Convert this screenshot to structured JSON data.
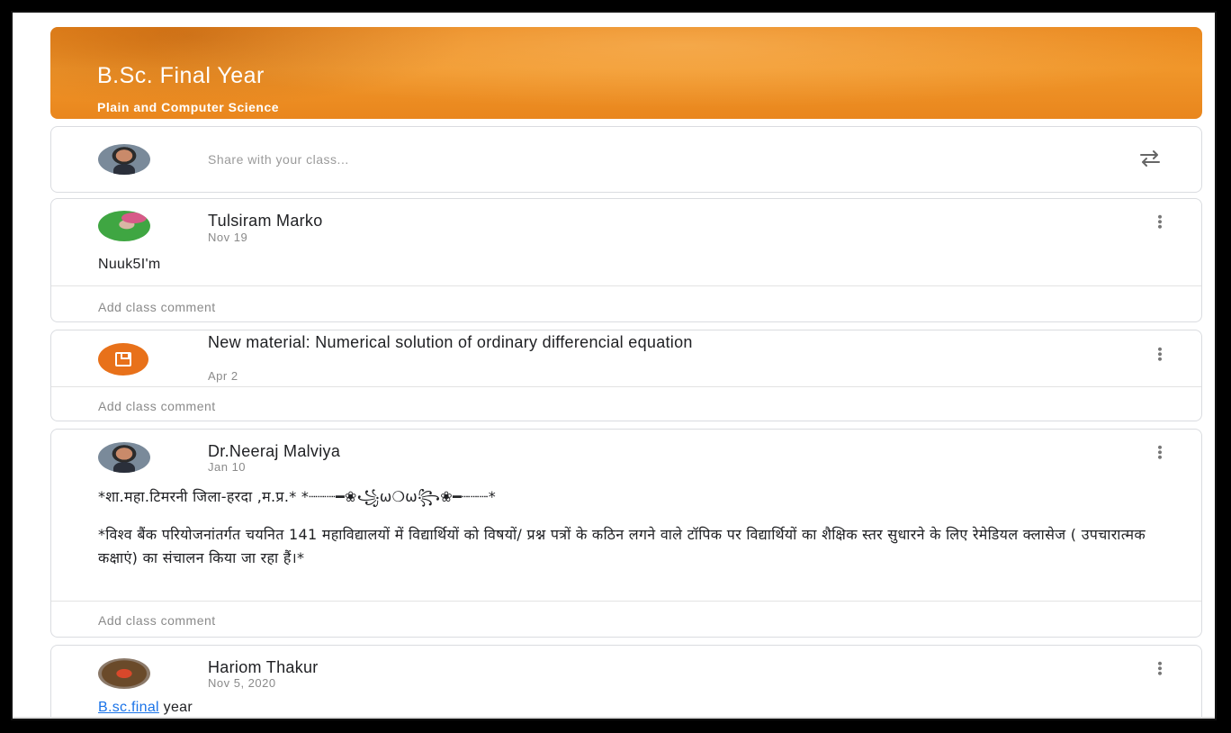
{
  "banner": {
    "title": "B.Sc. Final Year",
    "subtitle": "Plain and Computer Science",
    "color": "#E9871D"
  },
  "share": {
    "placeholder": "Share with your class...",
    "repost_icon": "repost-icon"
  },
  "posts": [
    {
      "author": "Tulsiram Marko",
      "date": "Nov 19",
      "text": "Nuuk5I'm",
      "comment_label": "Add class comment"
    },
    {
      "author": "New material: Numerical solution of ordinary differencial equation",
      "date": "Apr 2",
      "icon": "material-icon",
      "comment_label": "Add class comment"
    },
    {
      "author": "Dr.Neeraj Malviya",
      "date": "Jan 10",
      "line1": "*शा.महा.टिमरनी जिला-हरदा ,म.प्र.* *┈┈┈━❀꧁ω❍ω꧂❀━┈┈┈*",
      "line2": "*विश्व बैंक परियोजनांतर्गत चयनित 141 महाविद्यालयों में विद्यार्थियों को विषयों/ प्रश्न पत्रों के कठिन लगने वाले टॉपिक पर विद्यार्थियों का शैक्षिक स्तर सुधारने के लिए रेमेडियल क्लासेज ( उपचारात्मक कक्षाएं) का संचालन किया जा रहा हैं।*",
      "comment_label": "Add class comment"
    },
    {
      "author": "Hariom Thakur",
      "date": "Nov 5, 2020",
      "link_text": "B.sc.final",
      "text_rest": " year"
    }
  ],
  "colors": {
    "accent": "#E8711A",
    "link": "#1A73E8",
    "muted": "#8A8A8A"
  }
}
